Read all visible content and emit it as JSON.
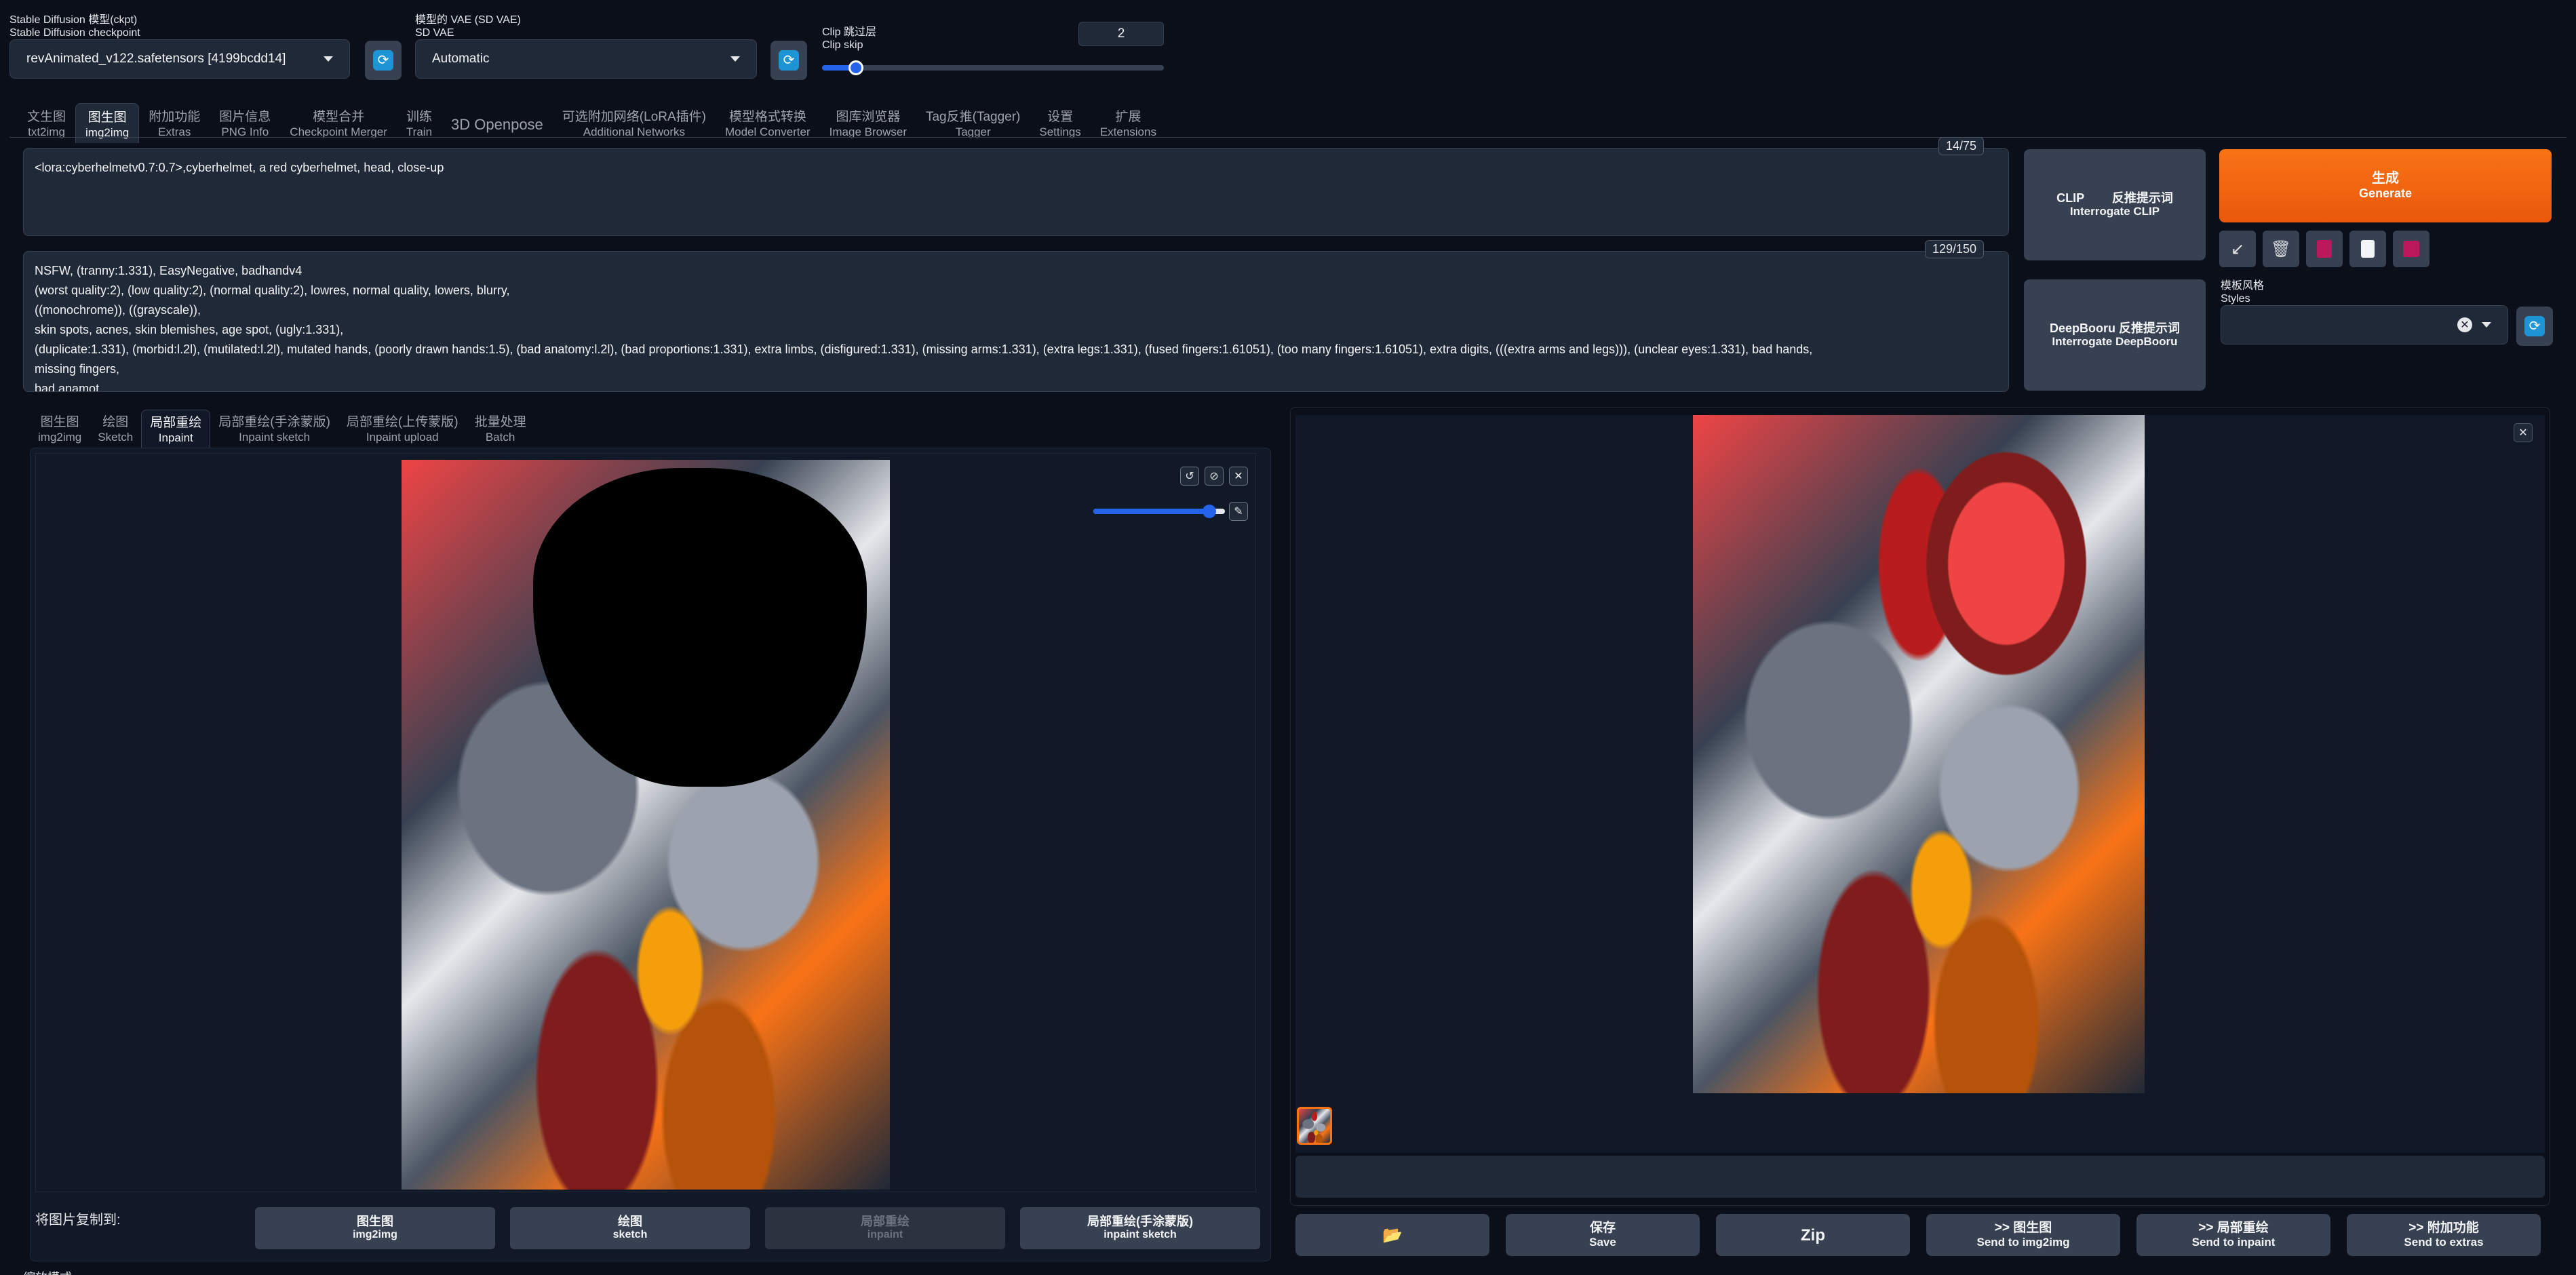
{
  "header": {
    "ckpt_label_cn": "Stable Diffusion 模型(ckpt)",
    "ckpt_label_en": "Stable Diffusion checkpoint",
    "ckpt_value": "revAnimated_v122.safetensors [4199bcdd14]",
    "vae_label_cn": "模型的 VAE (SD VAE)",
    "vae_label_en": "SD VAE",
    "vae_value": "Automatic",
    "clip_label_cn": "Clip 跳过层",
    "clip_label_en": "Clip skip",
    "clip_value": "2"
  },
  "main_tabs": [
    {
      "cn": "文生图",
      "en": "txt2img"
    },
    {
      "cn": "图生图",
      "en": "img2img"
    },
    {
      "cn": "附加功能",
      "en": "Extras"
    },
    {
      "cn": "图片信息",
      "en": "PNG Info"
    },
    {
      "cn": "模型合并",
      "en": "Checkpoint Merger"
    },
    {
      "cn": "训练",
      "en": "Train"
    },
    {
      "cn": "3D Openpose",
      "en": ""
    },
    {
      "cn": "可选附加网络(LoRA插件)",
      "en": "Additional Networks"
    },
    {
      "cn": "模型格式转换",
      "en": "Model Converter"
    },
    {
      "cn": "图库浏览器",
      "en": "Image Browser"
    },
    {
      "cn": "Tag反推(Tagger)",
      "en": "Tagger"
    },
    {
      "cn": "设置",
      "en": "Settings"
    },
    {
      "cn": "扩展",
      "en": "Extensions"
    }
  ],
  "prompt": {
    "text": "<lora:cyberhelmetv0.7:0.7>,cyberhelmet, a red cyberhelmet, head, close-up",
    "counter": "14/75"
  },
  "negative": {
    "lines": [
      "NSFW, (tranny:1.331), EasyNegative, badhandv4",
      "(worst quality:2), (low quality:2), (normal quality:2), lowres, normal quality, lowers, blurry,",
      "((monochrome)), ((grayscale)),",
      "skin spots, acnes, skin blemishes, age spot, (ugly:1.331),",
      "(duplicate:1.331), (morbid:l.2l), (mutilated:l.2l), mutated hands, (poorly drawn hands:1.5), (bad anatomy:l.2l), (bad proportions:1.331), extra limbs, (disfigured:1.331), (missing arms:1.331), (extra legs:1.331), (fused fingers:1.61051), (too many fingers:1.61051), extra digits, (((extra arms and legs))), (unclear eyes:1.331), bad hands,",
      "missing fingers,",
      "bad anamot"
    ],
    "counter": "129/150"
  },
  "interrogate": {
    "clip_cn": "CLIP 　　反推提示词",
    "clip_en": "Interrogate CLIP",
    "deepbooru_cn": "DeepBooru 反推提示词",
    "deepbooru_en": "Interrogate DeepBooru"
  },
  "generate": {
    "cn": "生成",
    "en": "Generate"
  },
  "styles": {
    "label_cn": "模板风格",
    "label_en": "Styles"
  },
  "sub_tabs": [
    {
      "cn": "图生图",
      "en": "img2img"
    },
    {
      "cn": "绘图",
      "en": "Sketch"
    },
    {
      "cn": "局部重绘",
      "en": "Inpaint"
    },
    {
      "cn": "局部重绘(手涂蒙版)",
      "en": "Inpaint sketch"
    },
    {
      "cn": "局部重绘(上传蒙版)",
      "en": "Inpaint upload"
    },
    {
      "cn": "批量处理",
      "en": "Batch"
    }
  ],
  "copy_to": {
    "label": "将图片复制到:",
    "buttons": [
      {
        "cn": "图生图",
        "en": "img2img"
      },
      {
        "cn": "绘图",
        "en": "sketch"
      },
      {
        "cn": "局部重绘",
        "en": "inpaint"
      },
      {
        "cn": "局部重绘(手涂蒙版)",
        "en": "inpaint sketch"
      }
    ]
  },
  "footer_label": "缩放模式",
  "output_actions": [
    {
      "cn": "📂",
      "en": ""
    },
    {
      "cn": "保存",
      "en": "Save"
    },
    {
      "cn": "Zip",
      "en": ""
    },
    {
      "cn": ">> 图生图",
      "en": "Send to img2img"
    },
    {
      "cn": ">> 局部重绘",
      "en": "Send to inpaint"
    },
    {
      "cn": ">> 附加功能",
      "en": "Send to extras"
    }
  ],
  "brush_level": 0.88,
  "clip_skip_level": 0.1,
  "colors": {
    "accent": "#f97316",
    "blue": "#1d94d6",
    "bg": "#0b0f19"
  }
}
